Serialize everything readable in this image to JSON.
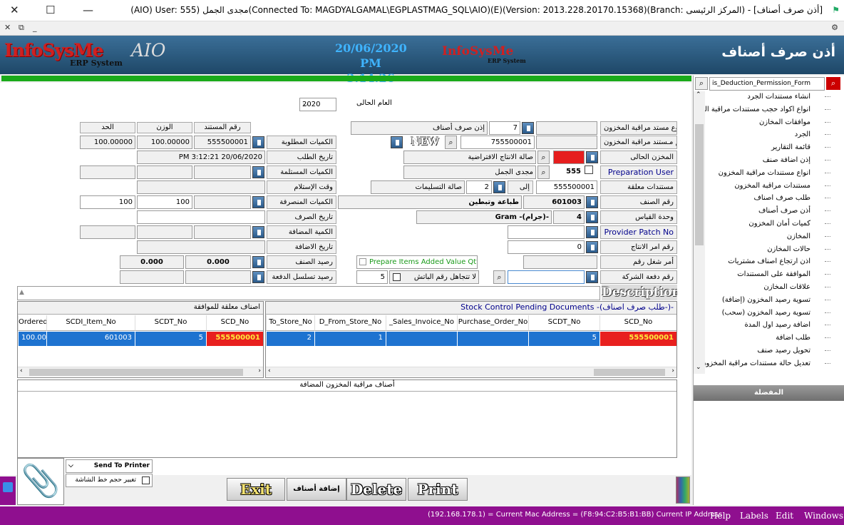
{
  "window": {
    "title": "(AIO) User: 555) مجدى الجمل(Connected To: MAGDYALGAMAL\\EGPLASTMAG_SQL\\AIO)(E)(Version: 2013.228.20170.15368)(Branch: المركز الرئيسى) - [أذن صرف أصناف]"
  },
  "banner": {
    "logo": "InfoSysMe",
    "logo_sub": "ERP System",
    "aio": "AIO",
    "date": "20/06/2020",
    "time": "PM 3:14:26",
    "logo2": "InfoSysMe",
    "logo2_sub": "ERP System",
    "form_title": "أذن صرف أصناف"
  },
  "form": {
    "year_label": "العام الحالى",
    "year_value": "2020",
    "doc_type_label": "نــوع مستد مراقبة المخزون",
    "doc_type_code": "7",
    "doc_type_name": "إذن صرف أصناف",
    "doc_no_label": "رقم مـستند مراقبة المخزون",
    "doc_no_value": "755500001",
    "new_label": "NEW",
    "store_label": "المخزن الحالى",
    "store_name": "صالة الانتاج الافتراضية",
    "prep_user_label": "Preparation User",
    "prep_user_code": "555",
    "prep_user_name": "مجدى الجمل",
    "pending_docs_label": "مستندات معلقة",
    "pending_docs_value": "555500001",
    "to_label": "إلى",
    "to_code": "2",
    "to_store": "صالة التسليمات",
    "item_no_label": "رقم الصنف",
    "item_no_value": "601003",
    "item_name": "طباعة وتبطين",
    "uom_label": "وحدة القياس",
    "uom_code": "4",
    "uom_name": "Gram -(جرام)-",
    "provider_patch_label": "Provider Patch No",
    "prod_order_label": "رقم امر الانتاج",
    "prod_order_value": "0",
    "work_order_label": "أمر شغل رقم",
    "company_batch_label": "رقم دفعة الشركة",
    "prepare_vat_label": "Prepare Items Added Value Qty",
    "ignore_batch_label": "لا تتجاهل رقم الباتش",
    "ignore_batch_value": "5",
    "doc_no_hdr": "رقم المستند",
    "weight_hdr": "الوزن",
    "limit_hdr": "الحد",
    "req_qty_label": "الكميات المطلوبة",
    "req_doc": "555500001",
    "req_weight": "100.00000",
    "req_limit": "100.00000",
    "req_date_label": "تاريخ الطلب",
    "req_date_value": "PM 3:12:21 20/06/2020",
    "received_qty_label": "الكميات المستلمة",
    "receive_time_label": "وقت الإستلام",
    "issued_qty_label": "الكميات المنصرفة",
    "issued_weight": "100",
    "issued_limit": "100",
    "issue_date_label": "تاريخ الصرف",
    "added_qty_label": "الكمية المضافة",
    "added_date_label": "تاريخ الاضافة",
    "item_balance_label": "رصيد الصنف",
    "item_balance_a": "0.000",
    "item_balance_b": "0.000",
    "batch_balance_label": "رصيد تسلسل الدفعة",
    "description_label": "Description"
  },
  "grid_left": {
    "title": "اصناف معلقة للموافقة",
    "cols": [
      "SCD_No",
      "SCDT_No",
      "SCDI_Item_No",
      "Ordered"
    ],
    "row": [
      "555500001",
      "5",
      "601003",
      "100.00000"
    ]
  },
  "grid_right": {
    "title": "Stock Control Pending Documents -(طلب صرف اصناف-)-",
    "cols": [
      "SCD_No",
      "SCDT_No",
      "Purchase_Order_No",
      "_Sales_Invoice_No",
      "D_From_Store_No",
      "To_Store_No"
    ],
    "row": [
      "555500001",
      "5",
      "",
      "",
      "1",
      "2"
    ]
  },
  "grid_bottom": {
    "title": "أصناف مراقبة المخزون المضافة"
  },
  "bottom": {
    "send_printer": "Send To Printer",
    "font_resize": "تغيير حجم خط الشاشة",
    "add_items": "إضافة أصناف",
    "exit": "Exit",
    "delete": "Delete",
    "print": "Print"
  },
  "sidebar": {
    "search_value": "is_Deduction_Permission_Form",
    "footer": "المفضلة",
    "items": [
      "انشاء مستندات الجرد",
      "انواع اكواد حجب مستندات مراقبة المخزو",
      "موافقات المخازن",
      "الجرد",
      "قائمة التقارير",
      "إذن اضافة صنف",
      "انواع مستندات مراقبة المخزون",
      "مستندات مراقبة المخزون",
      "طلب صرف اصناف",
      "أذن صرف أصناف",
      "كميات أمان المخزون",
      "المخازن",
      "حالات المخازن",
      "اذن ارتجاع اصناف مشتريات",
      "الموافقة على المستندات",
      "علاقات المخازن",
      "تسوية رصيد المخزون (إضافة)",
      "تسوية رصيد المخزون (سحب)",
      "اضافة رصيد اول المدة",
      "طلب اضافة",
      "تحويل رصيد صنف",
      "تعديل حالة مستندات مراقبة المخزون"
    ]
  },
  "status": {
    "ip": "(192.168.178.1) = Current Mac Address = (F8:94:C2:B5:B1:BB) Current IP Address",
    "help": "Help",
    "labels": "Labels",
    "edit": "Edit",
    "windows": "Windows"
  }
}
